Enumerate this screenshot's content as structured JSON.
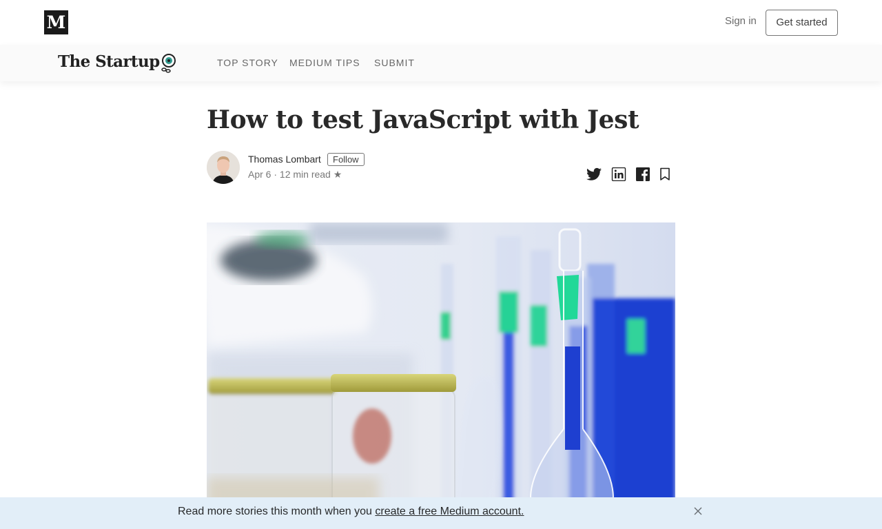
{
  "header": {
    "logo_letter": "M",
    "signin_label": "Sign in",
    "get_started_label": "Get started"
  },
  "publication": {
    "name": "The Startup",
    "nav": [
      "TOP STORY",
      "MEDIUM TIPS",
      "SUBMIT"
    ]
  },
  "article": {
    "title": "How to test JavaScript with Jest",
    "author": "Thomas Lombart",
    "follow_label": "Follow",
    "meta": "Apr 6 · 12 min read ★"
  },
  "share_icons": [
    "twitter-icon",
    "linkedin-icon",
    "facebook-icon",
    "bookmark-icon"
  ],
  "banner": {
    "text": "Read more stories this month when you ",
    "link": "create a free Medium account."
  },
  "colors": {
    "banner_bg": "#e2eef8",
    "pubbar_bg": "#fafafa",
    "logo_bg": "#1a1a1a"
  }
}
